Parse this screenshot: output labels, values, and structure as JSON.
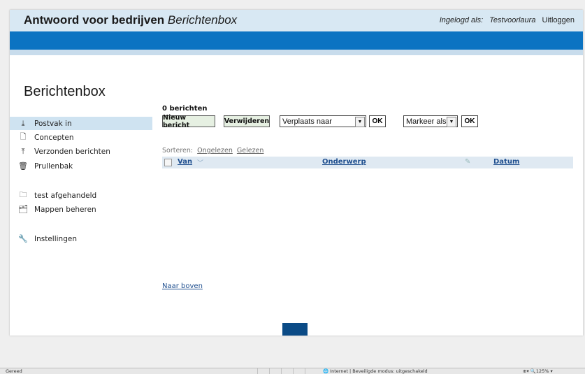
{
  "header": {
    "app_name_bold": "Antwoord voor bedrijven",
    "app_name_italic": "Berichtenbox",
    "logged_in_label": "Ingelogd als:",
    "username": "Testvoorlaura",
    "logout": "Uitloggen"
  },
  "page_title": "Berichtenbox",
  "sidebar": {
    "items": [
      {
        "label": "Postvak in",
        "icon": "inbox-icon",
        "glyph": "⤓",
        "active": true
      },
      {
        "label": "Concepten",
        "icon": "draft-icon",
        "glyph": "🗋",
        "active": false
      },
      {
        "label": "Verzonden berichten",
        "icon": "sent-icon",
        "glyph": "⤒",
        "active": false
      },
      {
        "label": "Prullenbak",
        "icon": "trash-icon",
        "glyph": "🗑",
        "active": false
      },
      {
        "label": "test afgehandeld",
        "icon": "folder-icon",
        "glyph": "🗀",
        "active": false
      },
      {
        "label": "Mappen beheren",
        "icon": "manage-folders-icon",
        "glyph": "🗂",
        "active": false
      },
      {
        "label": "Instellingen",
        "icon": "wrench-icon",
        "glyph": "🔧",
        "active": false
      }
    ]
  },
  "main": {
    "message_count": "0 berichten",
    "new_message_button": "Nieuw bericht",
    "delete_button": "Verwijderen",
    "move_select": "Verplaats naar",
    "move_ok": "OK",
    "mark_select": "Markeer als",
    "mark_ok": "OK",
    "sort_label": "Sorteren:",
    "sort_unread": "Ongelezen",
    "sort_read": "Gelezen",
    "columns": {
      "from": "Van",
      "subject": "Onderwerp",
      "date": "Datum"
    },
    "back_to_top": "Naar boven"
  },
  "statusbar": {
    "left": "Gereed",
    "zone": "Internet | Beveiligde modus: uitgeschakeld",
    "zoom": "125%"
  },
  "colors": {
    "header_bg": "#d8e8f3",
    "blue_bar": "#0b73c2",
    "nav_block": "#0b4b86",
    "active_item": "#cfe3f1"
  }
}
